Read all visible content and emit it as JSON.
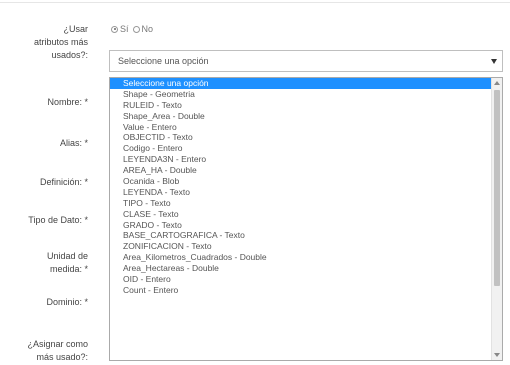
{
  "form": {
    "labels": {
      "use_attrs": "¿Usar\natributos más\nusados?:",
      "nombre": "Nombre: *",
      "alias": "Alias: *",
      "definicion": "Definición: *",
      "tipo_dato": "Tipo de Dato: *",
      "unidad": "Unidad de\nmedida: *",
      "dominio": "Dominio: *",
      "asignar": "¿Asignar como\nmás usado?:"
    },
    "radio": {
      "yes_label": "Sí",
      "no_label": "No",
      "selected": "Sí"
    },
    "select": {
      "value": "Seleccione una opción",
      "options": [
        "Seleccione una opción",
        "Shape - Geometria",
        "RULEID - Texto",
        "Shape_Area - Double",
        "Value - Entero",
        "OBJECTID - Texto",
        "Codigo - Entero",
        "LEYENDA3N - Entero",
        "AREA_HA - Double",
        "Ocanida - Blob",
        "LEYENDA - Texto",
        "TIPO - Texto",
        "CLASE - Texto",
        "GRADO - Texto",
        "BASE_CARTOGRAFICA - Texto",
        "ZONIFICACION - Texto",
        "Area_Kilometros_Cuadrados - Double",
        "Area_Hectareas - Double",
        "OID - Entero",
        "Count - Entero"
      ],
      "highlighted_index": 0
    }
  }
}
